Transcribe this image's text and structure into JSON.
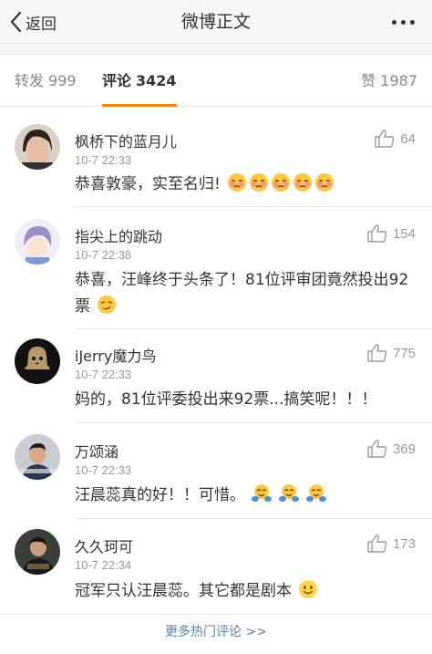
{
  "nav": {
    "back_label": "返回",
    "title": "微博正文"
  },
  "tabs": {
    "repost": {
      "label": "转发",
      "count": "999"
    },
    "comment": {
      "label": "评论",
      "count": "3424"
    },
    "likes": {
      "label": "赞",
      "count": "1987"
    }
  },
  "comments": [
    {
      "user": "枫桥下的蓝月儿",
      "time": "10-7 22:33",
      "text": "恭喜敦豪，实至名归!",
      "emoji": "shy-face x5",
      "likes": "64"
    },
    {
      "user": "指尖上的跳动",
      "time": "10-7 22:38",
      "text": "恭喜，汪峰终于头条了！81位评审团竟然投出92票",
      "emoji": "smirk-face",
      "likes": "154"
    },
    {
      "user": "iJerry魔力鸟",
      "time": "10-7 22:33",
      "text": "妈的，81位评委投出来92票...搞笑呢！！！",
      "likes": "775"
    },
    {
      "user": "万颂涵",
      "time": "10-7 22:33",
      "text": "汪晨蕊真的好！！可惜。",
      "emoji": "hug-face x3",
      "likes": "369"
    },
    {
      "user": "久久珂可",
      "time": "10-7 22:34",
      "text": "冠军只认汪晨蕊。其它都是剧本",
      "emoji": "smile-face",
      "likes": "173"
    }
  ],
  "more_link": "更多热门评论 >>",
  "colors": {
    "accent": "#ff8200",
    "link": "#5d7fae",
    "muted": "#999999"
  }
}
